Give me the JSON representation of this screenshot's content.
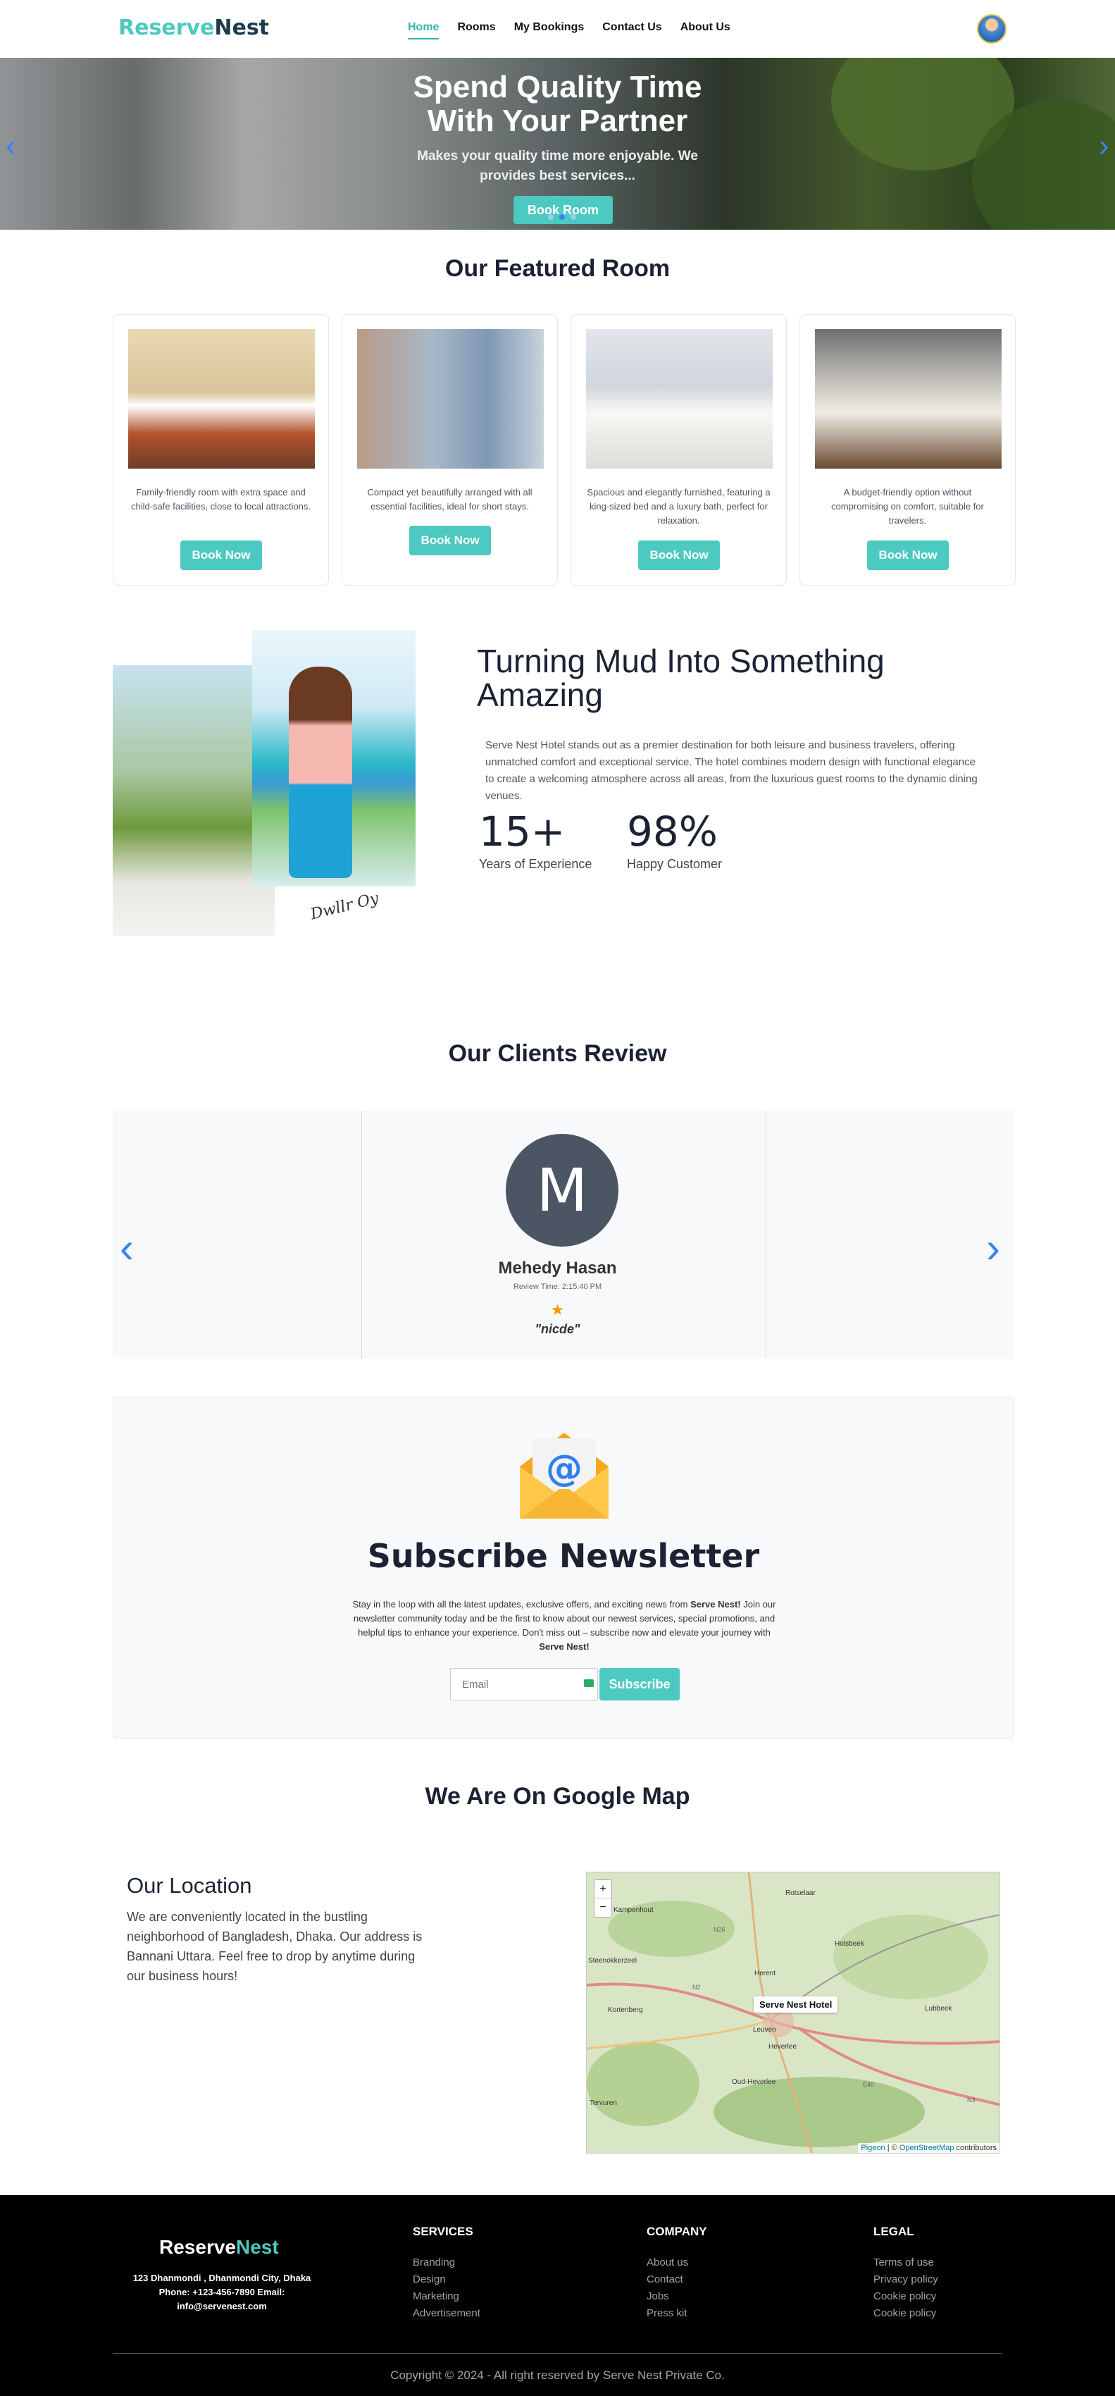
{
  "header": {
    "logo_part1": "Reserve",
    "logo_part2": "Nest",
    "nav": [
      "Home",
      "Rooms",
      "My Bookings",
      "Contact Us",
      "About Us"
    ]
  },
  "hero": {
    "title_line1": "Spend Quality Time",
    "title_line2": "With Your Partner",
    "subtitle_line1": "Makes your quality time more enjoyable. We",
    "subtitle_line2": "provides best services...",
    "button": "Book Room",
    "prev_arrow": "‹",
    "next_arrow": "›"
  },
  "featured": {
    "title": "Our Featured Room",
    "rooms": [
      {
        "desc": "Family-friendly room with extra space and child-safe facilities, close to local attractions.",
        "button": "Book Now"
      },
      {
        "desc": "Compact yet beautifully arranged with all essential facilities, ideal for short stays.",
        "button": "Book Now"
      },
      {
        "desc": "Spacious and elegantly furnished, featuring a king-sized bed and a luxury bath, perfect for relaxation.",
        "button": "Book Now"
      },
      {
        "desc": "A budget-friendly option without compromising on comfort, suitable for travelers.",
        "button": "Book Now"
      }
    ]
  },
  "about": {
    "title": "Turning Mud Into Something Amazing",
    "paragraph": "Serve Nest Hotel stands out as a premier destination for both leisure and business travelers, offering unmatched comfort and exceptional service. The hotel combines modern design with functional elegance to create a welcoming atmosphere across all areas, from the luxurious guest rooms to the dynamic dining venues.",
    "signature": "Dwllr Oy",
    "stats": [
      {
        "value": "15+",
        "label": "Years of Experience"
      },
      {
        "value": "98%",
        "label": "Happy Customer"
      }
    ]
  },
  "reviews": {
    "title": "Our Clients Review",
    "avatar_letter": "M",
    "name": "Mehedy Hasan",
    "time": "Review Time: 2:15:40 PM",
    "rating": 1,
    "star": "★",
    "text": "\"nicde\"",
    "prev_arrow": "‹",
    "next_arrow": "›"
  },
  "newsletter": {
    "icon_symbol": "@",
    "title": "Subscribe Newsletter",
    "para_part1": "Stay in the loop with all the latest updates, exclusive offers, and exciting news from ",
    "brand": "Serve Nest!",
    "para_part2": " Join our newsletter community today and be the first to know about our newest services, special promotions, and helpful tips to enhance your experience. Don't miss out – subscribe now and elevate your journey with ",
    "brand2": "Serve Nest!",
    "email_placeholder": "Email",
    "button": "Subscribe"
  },
  "map": {
    "title": "We Are On Google Map",
    "location_title": "Our Location",
    "location_text": "We are conveniently located in the bustling neighborhood of Bangladesh, Dhaka. Our address is Bannani Uttara. Feel free to drop by anytime during our business hours!",
    "marker_label": "Serve Nest Hotel",
    "zoom_in": "+",
    "zoom_out": "−",
    "place_labels": [
      "Kampenhout",
      "Rotselaar",
      "Holsbeek",
      "Herent",
      "Steenokkerzeel",
      "Kortenberg",
      "Leuven",
      "Lubbeek",
      "Heverlee",
      "Oud-Heverlee",
      "Tervuren"
    ],
    "road_labels": [
      "N26",
      "N2",
      "E40",
      "N3"
    ],
    "attr_link1": "Pigeon",
    "attr_sep": " | © ",
    "attr_link2": "OpenStreetMap",
    "attr_suffix": " contributors"
  },
  "footer": {
    "logo_part1": "Reserve",
    "logo_part2": "Nest",
    "address": "123 Dhanmondi , Dhanmondi City, Dhaka",
    "phone_email": "Phone: +123-456-7890 Email:",
    "email": "info@servenest.com",
    "columns": [
      {
        "title": "SERVICES",
        "items": [
          "Branding",
          "Design",
          "Marketing",
          "Advertisement"
        ]
      },
      {
        "title": "COMPANY",
        "items": [
          "About us",
          "Contact",
          "Jobs",
          "Press kit"
        ]
      },
      {
        "title": "LEGAL",
        "items": [
          "Terms of use",
          "Privacy policy",
          "Cookie policy",
          "Cookie policy"
        ]
      }
    ],
    "copyright": "Copyright © 2024 - All right reserved by Serve Nest Private Co."
  },
  "colors": {
    "accent": "#4cc9c0",
    "dark": "#1a2233",
    "link_blue": "#3b82f6",
    "star": "#f59e0b"
  }
}
